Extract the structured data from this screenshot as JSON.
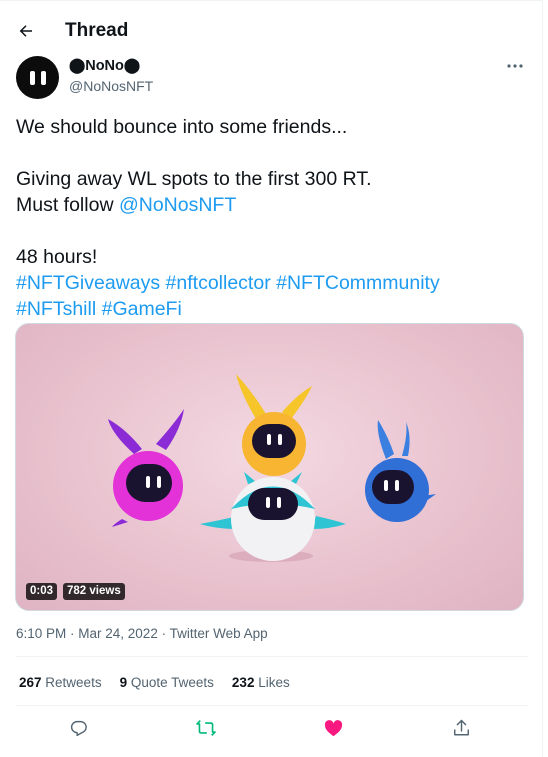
{
  "header": {
    "title": "Thread"
  },
  "author": {
    "name": "⬤NoNo⬤",
    "handle": "@NoNosNFT"
  },
  "tweet": {
    "line1": "We should bounce into some friends...",
    "line2": "Giving away WL spots to the first 300 RT.",
    "line3_prefix": "Must follow ",
    "line3_link": "@NoNosNFT",
    "line4": "48 hours!",
    "hashtags_row1": [
      "#NFTGiveaways",
      "#nftcollector",
      "#NFTCommmunity"
    ],
    "hashtags_row2": [
      "#NFTshill",
      "#GameFi"
    ]
  },
  "media": {
    "duration": "0:03",
    "views": "782 views"
  },
  "meta": {
    "time": "6:10 PM · Mar 24, 2022 · Twitter Web App"
  },
  "stats": {
    "retweets_count": "267",
    "retweets_label": "Retweets",
    "quotes_count": "9",
    "quotes_label": "Quote Tweets",
    "likes_count": "232",
    "likes_label": "Likes"
  },
  "colors": {
    "link": "#1d9bf0",
    "retweet": "#00ba7c",
    "like": "#f91880",
    "text": "#0f1419",
    "muted": "#536471"
  },
  "icons": [
    "back-arrow-icon",
    "more-icon",
    "reply-icon",
    "retweet-icon",
    "like-icon",
    "share-icon"
  ]
}
